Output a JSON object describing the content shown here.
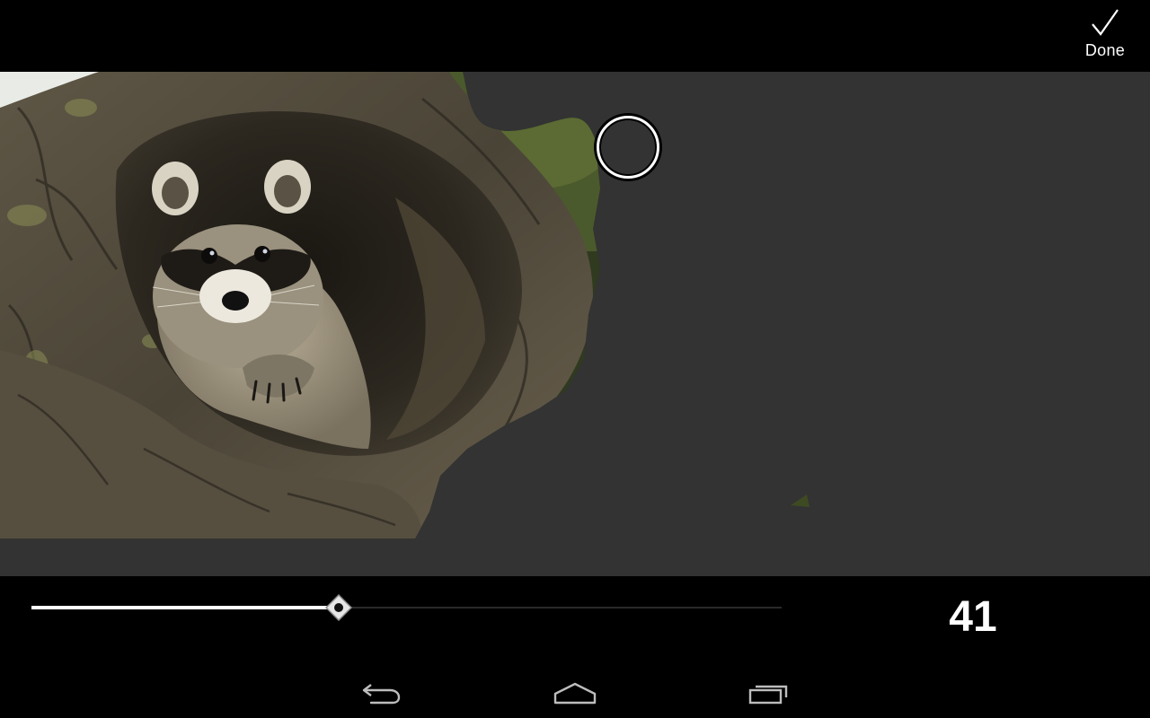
{
  "toolbar": {
    "done_label": "Done",
    "done_icon": "checkmark-icon"
  },
  "brush": {
    "size_value": "41",
    "slider_fraction": 0.41
  },
  "navigation": {
    "back_icon": "back-icon",
    "home_icon": "home-icon",
    "recents_icon": "recent-apps-icon"
  },
  "colors": {
    "background": "#000000",
    "masked_area": "#333333",
    "accent": "#ffffff"
  }
}
